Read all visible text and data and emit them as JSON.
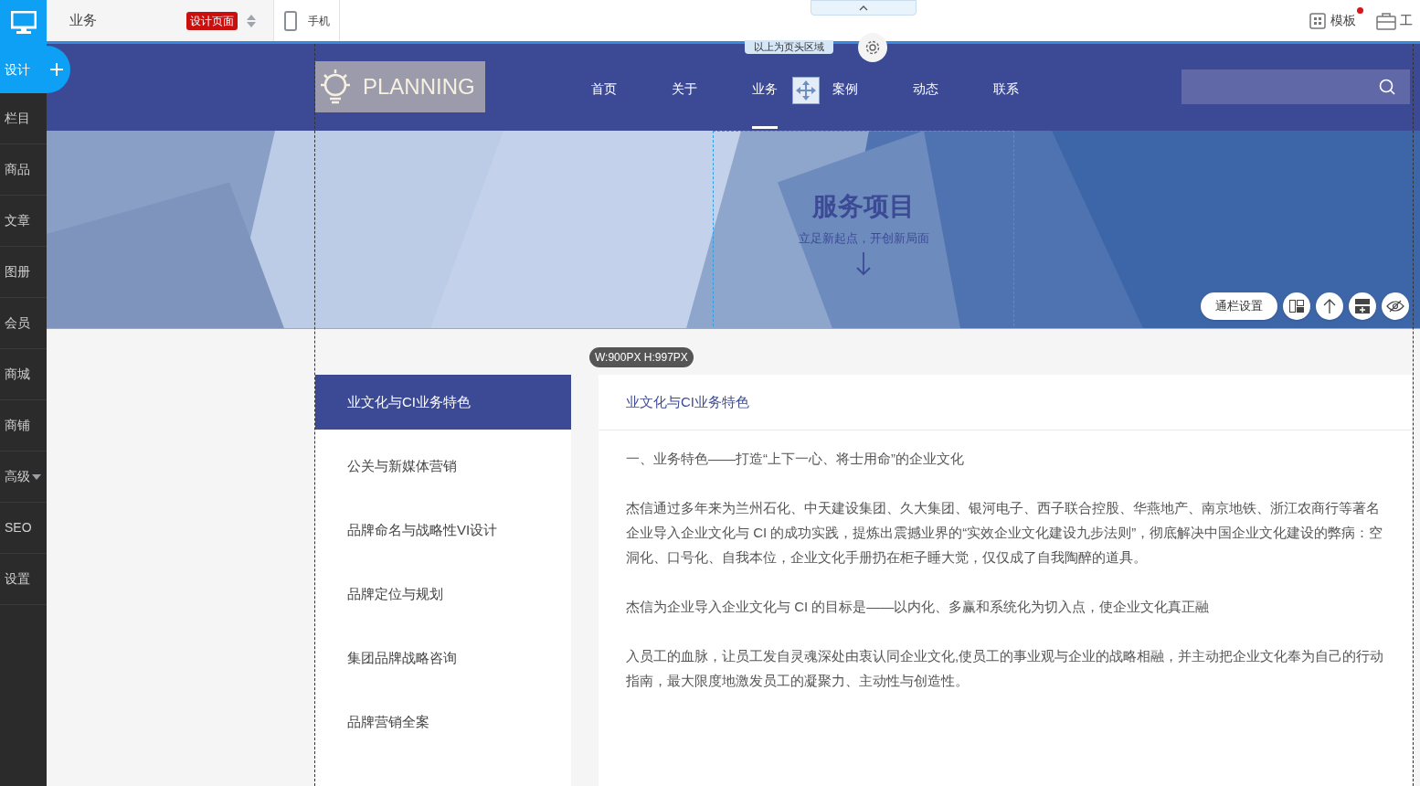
{
  "sidebar": {
    "items": [
      {
        "label": "设计",
        "selected": true,
        "kind": "add"
      },
      {
        "label": "栏目",
        "selected": false,
        "kind": "plain"
      },
      {
        "label": "商品",
        "selected": false,
        "kind": "plain"
      },
      {
        "label": "文章",
        "selected": false,
        "kind": "plain"
      },
      {
        "label": "图册",
        "selected": false,
        "kind": "plain"
      },
      {
        "label": "会员",
        "selected": false,
        "kind": "plain"
      },
      {
        "label": "商城",
        "selected": false,
        "kind": "plain"
      },
      {
        "label": "商铺",
        "selected": false,
        "kind": "plain"
      },
      {
        "label": "高级",
        "selected": false,
        "kind": "menu"
      },
      {
        "label": "SEO",
        "selected": false,
        "kind": "plain"
      },
      {
        "label": "设置",
        "selected": false,
        "kind": "plain"
      }
    ]
  },
  "topbar": {
    "page_name": "业务",
    "page_badge": "设计页面",
    "mobile_label": "手机",
    "right_items": [
      {
        "label": "模板",
        "notification": true,
        "kind": "template"
      },
      {
        "label": "工",
        "notification": false,
        "kind": "tools"
      }
    ]
  },
  "header": {
    "region_label": "以上为页头区域",
    "logo_text": "PLANNING",
    "nav": [
      {
        "label": "首页",
        "selected": false
      },
      {
        "label": "关于",
        "selected": false
      },
      {
        "label": "业务",
        "selected": true
      },
      {
        "label": "案例",
        "selected": false
      },
      {
        "label": "动态",
        "selected": false
      },
      {
        "label": "联系",
        "selected": false
      }
    ]
  },
  "banner": {
    "title": "服务项目",
    "subtitle": "立足新起点，开创新局面",
    "toolbar_label": "通栏设置"
  },
  "size_badge": "W:900PX H:997PX",
  "side_menu": [
    {
      "label": "业文化与CI业务特色",
      "selected": true
    },
    {
      "label": "公关与新媒体营销",
      "selected": false
    },
    {
      "label": "品牌命名与战略性VI设计",
      "selected": false
    },
    {
      "label": "品牌定位与规划",
      "selected": false
    },
    {
      "label": "集团品牌战略咨询",
      "selected": false
    },
    {
      "label": "品牌营销全案",
      "selected": false
    }
  ],
  "article": {
    "title": "业文化与CI业务特色",
    "paragraphs": [
      "一、业务特色——打造“上下一心、将士用命”的企业文化",
      "杰信通过多年来为兰州石化、中天建设集团、久大集团、银河电子、西子联合控股、华燕地产、南京地铁、浙江农商行等著名企业导入企业文化与 CI 的成功实践，提炼出震撼业界的“实效企业文化建设九步法则”，彻底解决中国企业文化建设的弊病：空洞化、口号化、自我本位，企业文化手册扔在柜子睡大觉，仅仅成了自我陶醉的道具。",
      "杰信为企业导入企业文化与 CI 的目标是——以内化、多赢和系统化为切入点，使企业文化真正融",
      "入员工的血脉，让员工发自灵魂深处由衷认同企业文化,使员工的事业观与企业的战略相融，并主动把企业文化奉为自己的行动指南，最大限度地激发员工的凝聚力、主动性与创造性。"
    ]
  }
}
